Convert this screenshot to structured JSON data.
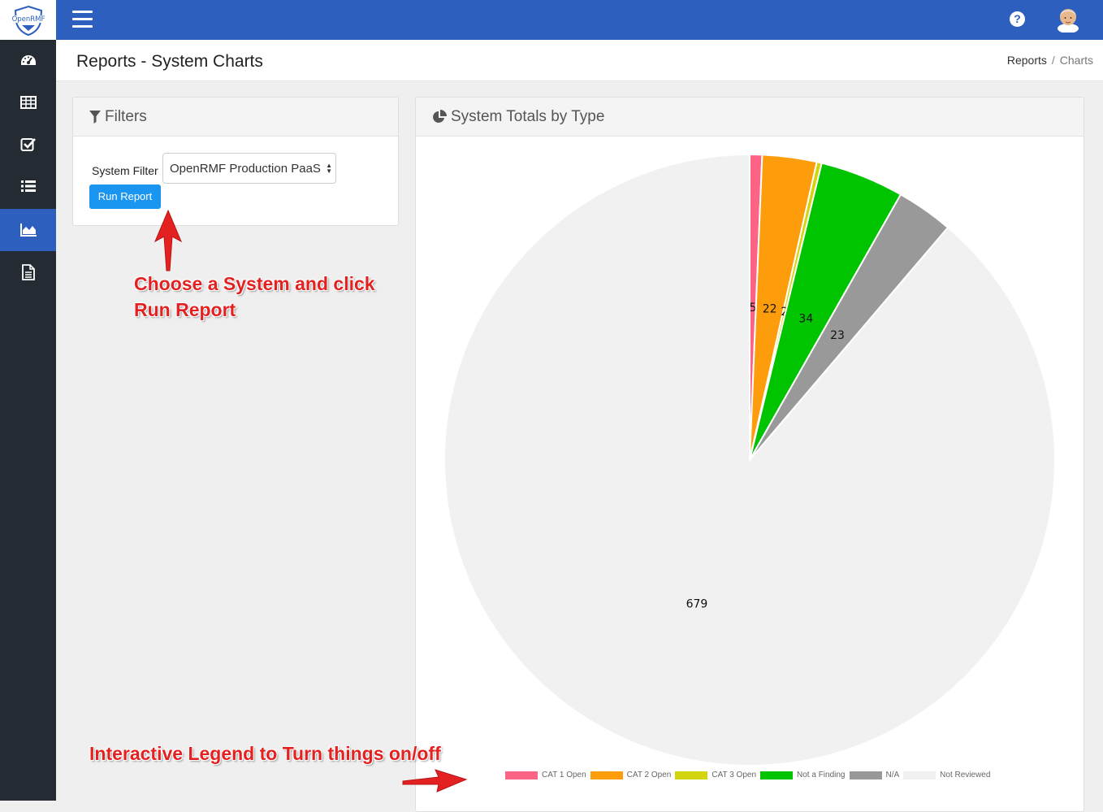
{
  "app": {
    "logo_text": "OpenRMF"
  },
  "sidebar": {
    "items": [
      {
        "icon": "dashboard-icon"
      },
      {
        "icon": "table-icon"
      },
      {
        "icon": "checkbox-icon"
      },
      {
        "icon": "list-icon"
      },
      {
        "icon": "chart-icon",
        "active": true
      },
      {
        "icon": "document-icon"
      }
    ]
  },
  "topbar": {
    "help_icon": "?"
  },
  "header": {
    "title": "Reports - System Charts",
    "breadcrumb": {
      "parent": "Reports",
      "separator": "/",
      "current": "Charts"
    }
  },
  "filters": {
    "title": "Filters",
    "system_filter_label": "System Filter",
    "system_filter_value": "OpenRMF Production PaaS",
    "run_button": "Run Report"
  },
  "chart_panel": {
    "title": "System Totals by Type"
  },
  "chart_data": {
    "type": "pie",
    "categories": [
      "CAT 1 Open",
      "CAT 2 Open",
      "CAT 3 Open",
      "Not a Finding",
      "N/A",
      "Not Reviewed"
    ],
    "values": [
      5,
      22,
      2,
      34,
      23,
      679
    ],
    "colors": [
      "#fd6385",
      "#fd9d0b",
      "#d4d40a",
      "#00c400",
      "#999999",
      "#f1f1f1"
    ],
    "legend_position": "bottom"
  },
  "annotations": {
    "choose_system": [
      "Choose a System and click",
      "Run Report"
    ],
    "legend_hint": "Interactive Legend to Turn things on/off"
  }
}
